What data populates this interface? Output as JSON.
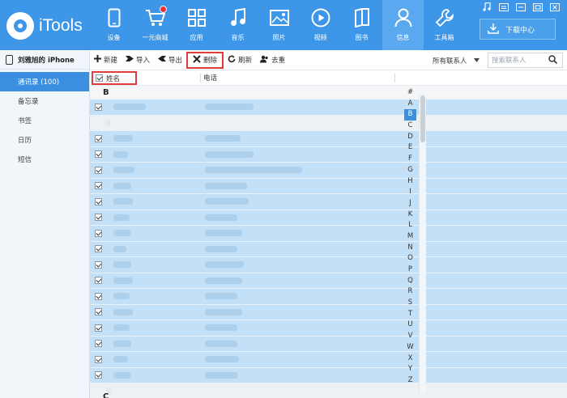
{
  "app": {
    "name": "iTools"
  },
  "nav": [
    {
      "label": "设备",
      "icon": "phone-icon"
    },
    {
      "label": "一元商城",
      "icon": "cart-icon"
    },
    {
      "label": "应用",
      "icon": "apps-icon"
    },
    {
      "label": "音乐",
      "icon": "music-icon"
    },
    {
      "label": "照片",
      "icon": "photo-icon"
    },
    {
      "label": "视频",
      "icon": "video-icon"
    },
    {
      "label": "图书",
      "icon": "book-icon"
    },
    {
      "label": "信息",
      "icon": "user-icon"
    },
    {
      "label": "工具箱",
      "icon": "wrench-icon"
    }
  ],
  "download_center": "下载中心",
  "device_name": "刘雅旭的 iPhone",
  "sidebar": [
    {
      "label": "通讯录 (100)"
    },
    {
      "label": "备忘录"
    },
    {
      "label": "书签"
    },
    {
      "label": "日历"
    },
    {
      "label": "短信"
    }
  ],
  "toolbar": {
    "new": "新建",
    "import": "导入",
    "export": "导出",
    "delete": "删除",
    "refresh": "刷新",
    "dedupe": "去重",
    "contact_filter": "所有联系人",
    "search_placeholder": "搜索联系人"
  },
  "table": {
    "col_name": "姓名",
    "col_phone": "电话",
    "group_letter": "B",
    "group_letter_bottom": "C"
  },
  "alphabet": [
    "#",
    "A",
    "B",
    "C",
    "D",
    "E",
    "F",
    "G",
    "H",
    "I",
    "J",
    "K",
    "L",
    "M",
    "N",
    "O",
    "P",
    "Q",
    "R",
    "S",
    "T",
    "U",
    "V",
    "W",
    "X",
    "Y",
    "Z"
  ],
  "colors": {
    "brand": "#3d96e8",
    "highlight": "#e23b3b",
    "selected_row": "#c4e0f7"
  }
}
